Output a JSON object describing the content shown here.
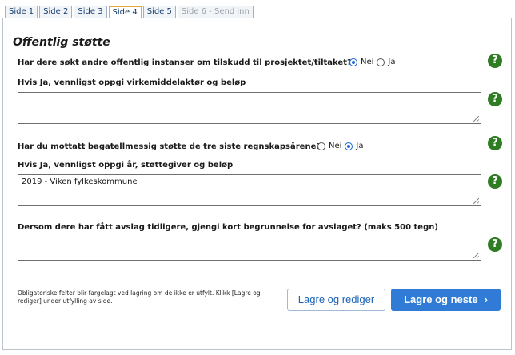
{
  "tabs": [
    {
      "label": "Side 1"
    },
    {
      "label": "Side 2"
    },
    {
      "label": "Side 3"
    },
    {
      "label": "Side 4"
    },
    {
      "label": "Side 5"
    },
    {
      "label": "Side 6 - Send inn"
    }
  ],
  "active_tab": "Side 4",
  "section": {
    "title": "Offentlig støtte"
  },
  "q1": {
    "label": "Har dere søkt andre offentlig instanser om tilskudd til prosjektet/tiltaket?",
    "options": [
      "Nei",
      "Ja"
    ],
    "selected": "Nei"
  },
  "q1_followup": {
    "label": "Hvis Ja, vennligst oppgi virkemiddelaktør og beløp",
    "value": ""
  },
  "q2": {
    "label": "Har du mottatt bagatellmessig støtte de tre siste regnskapsårene?",
    "options": [
      "Nei",
      "Ja"
    ],
    "selected": "Ja"
  },
  "q2_followup": {
    "label": "Hvis Ja, vennligst oppgi år, støttegiver og beløp",
    "value": "2019 - Viken fylkeskommune"
  },
  "q3": {
    "label": "Dersom dere har fått avslag tidligere, gjengi kort begrunnelse for avslaget? (maks 500 tegn)",
    "value": ""
  },
  "help_icon": "question-mark",
  "footnote": "Obligatoriske felter blir fargelagt ved lagring om de ikke er utfylt. Klikk [Lagre og rediger] under utfylling av side.",
  "buttons": {
    "save_edit": "Lagre og rediger",
    "save_next": "Lagre og neste"
  },
  "colors": {
    "primary": "#2f7bd6",
    "help_green": "#2e7d22",
    "active_tab_accent": "#e3a83a"
  }
}
